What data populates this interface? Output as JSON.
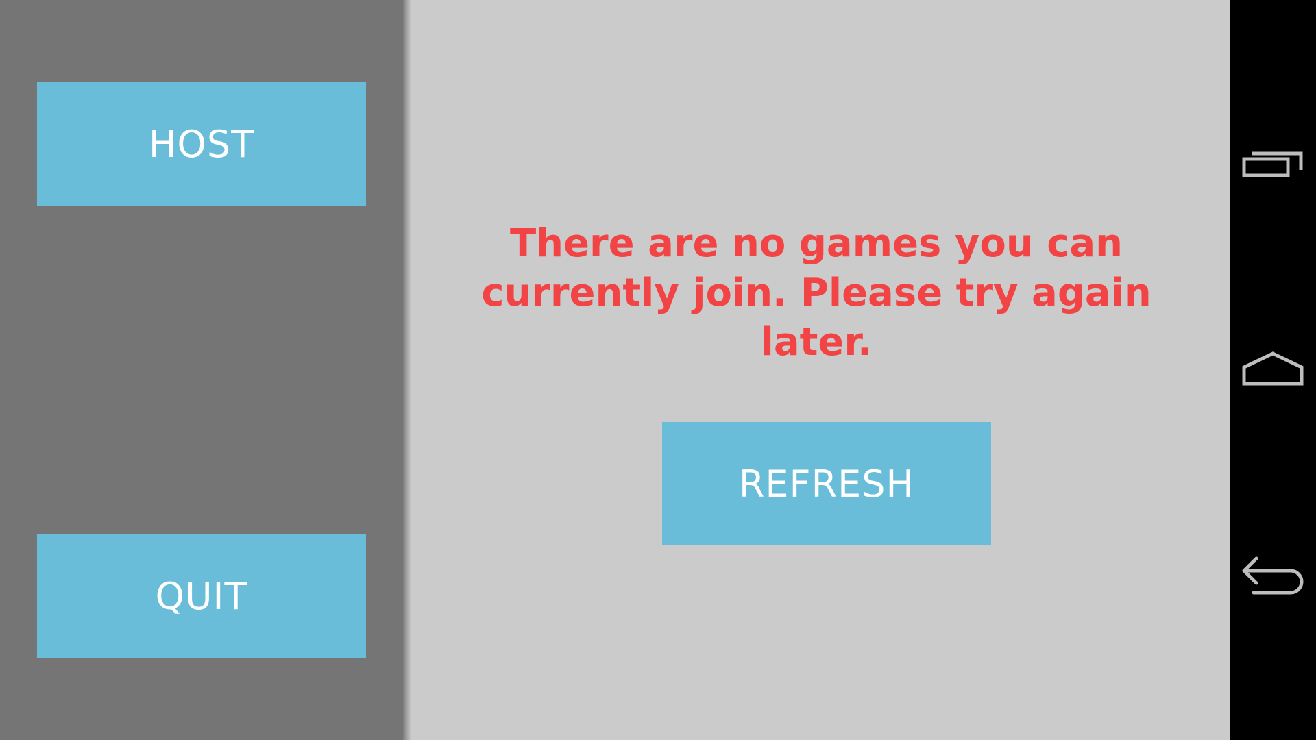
{
  "sidebar": {
    "host_label": "HOST",
    "quit_label": "QUIT"
  },
  "main": {
    "message": "There are no games you can currently join. Please try again later.",
    "refresh_label": "REFRESH"
  },
  "navbar": {
    "icons": [
      "recent-apps-icon",
      "home-icon",
      "back-icon"
    ]
  },
  "colors": {
    "sidebar_bg": "#757575",
    "main_bg": "#cbcbcb",
    "button_bg": "#6abdd9",
    "button_text": "#ffffff",
    "message_text": "#f24444",
    "navbar_bg": "#000000"
  }
}
